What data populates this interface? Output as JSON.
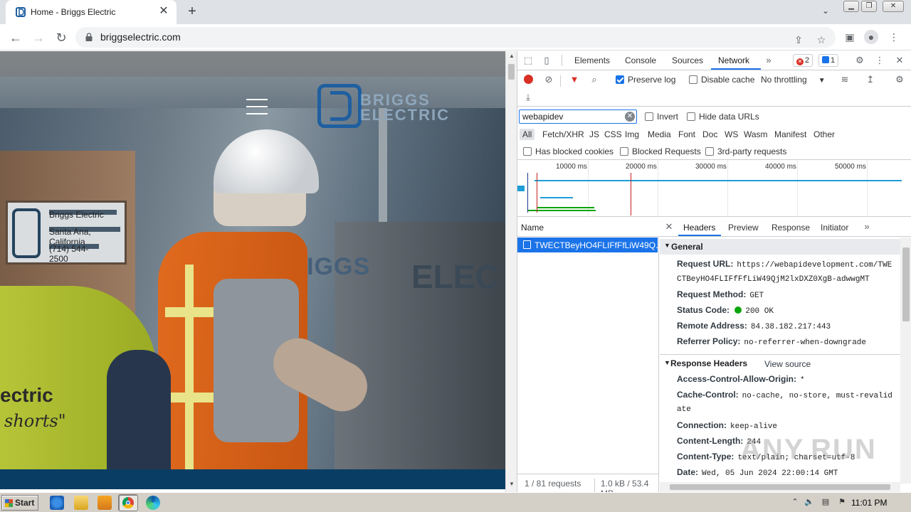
{
  "browser": {
    "tab_title": "Home - Briggs Electric",
    "url": "briggselectric.com"
  },
  "website": {
    "logo_line1": "BRIGGS",
    "logo_line2": "ELECTRIC",
    "board_text_1": "Briggs Electric",
    "board_text_2": "Santa Ana, California",
    "board_text_3": "(714) 544-2500",
    "cabinet_text": "BRIGGS",
    "cabinet_text_2": "ELEC",
    "left_shirt_text_1": "ectric",
    "left_shirt_text_2": "shorts\""
  },
  "devtools": {
    "tabs": [
      "Elements",
      "Console",
      "Sources",
      "Network"
    ],
    "active_tab": "Network",
    "errors_count": "2",
    "messages_count": "1",
    "toolbar": {
      "preserve_log": "Preserve log",
      "disable_cache": "Disable cache",
      "throttling": "No throttling"
    },
    "filter": {
      "value": "webapidev",
      "invert": "Invert",
      "hide_data_urls": "Hide data URLs"
    },
    "types": [
      "All",
      "Fetch/XHR",
      "JS",
      "CSS",
      "Img",
      "Media",
      "Font",
      "Doc",
      "WS",
      "Wasm",
      "Manifest",
      "Other"
    ],
    "blocked": {
      "has_blocked_cookies": "Has blocked cookies",
      "blocked_requests": "Blocked Requests",
      "third_party": "3rd-party requests"
    },
    "timeline_ticks": [
      "10000 ms",
      "20000 ms",
      "30000 ms",
      "40000 ms",
      "50000 ms"
    ],
    "request_list": {
      "header": "Name",
      "selected_request": "TWECTBeyHO4FLIFfFfLiW49Q...",
      "footer_requests": "1 / 81 requests",
      "footer_size": "1.0 kB / 53.4 MB"
    },
    "detail_tabs": [
      "Headers",
      "Preview",
      "Response",
      "Initiator"
    ],
    "general": {
      "title": "General",
      "request_url_label": "Request URL:",
      "request_url_value_1": "https://webapidevelopment.com/TWE",
      "request_url_value_2": "CTBeyHO4FLIFfFfLiW49QjM2lxDXZ0XgB-adwwgMT",
      "request_method_label": "Request Method:",
      "request_method_value": "GET",
      "status_code_label": "Status Code:",
      "status_code_value": "200 OK",
      "remote_address_label": "Remote Address:",
      "remote_address_value": "84.38.182.217:443",
      "referrer_policy_label": "Referrer Policy:",
      "referrer_policy_value": "no-referrer-when-downgrade"
    },
    "response_headers": {
      "title": "Response Headers",
      "view_source": "View source",
      "acao_label": "Access-Control-Allow-Origin:",
      "acao_value": "*",
      "cache_control_label": "Cache-Control:",
      "cache_control_value_1": "no-cache, no-store, must-revalid",
      "cache_control_value_2": "ate",
      "connection_label": "Connection:",
      "connection_value": "keep-alive",
      "content_length_label": "Content-Length:",
      "content_length_value": "244",
      "content_type_label": "Content-Type:",
      "content_type_value": "text/plain; charset=utf-8",
      "date_label": "Date:",
      "date_value": "Wed, 05 Jun 2024 22:00:14 GMT"
    }
  },
  "watermark": "ANY.RUN",
  "taskbar": {
    "start_label": "Start",
    "clock": "11:01 PM"
  },
  "colors": {
    "devtools_accent": "#1a73e8",
    "status_ok": "#0ca40c",
    "record_red": "#d93025",
    "site_footer_blue": "#0a3d64"
  }
}
